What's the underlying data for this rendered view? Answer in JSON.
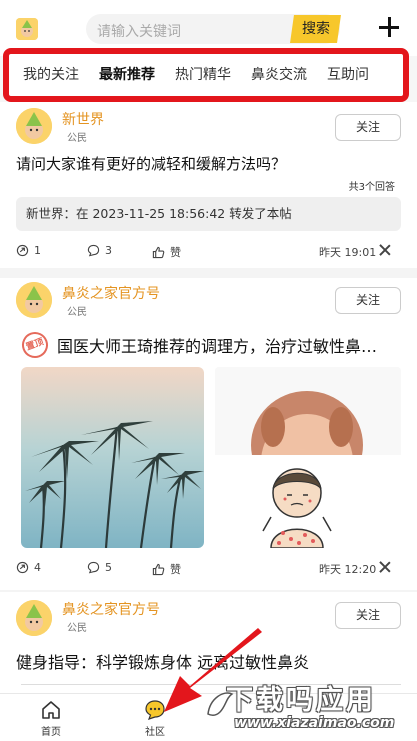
{
  "header": {
    "search_placeholder": "请输入关键词",
    "search_button": "搜索"
  },
  "tabs": [
    {
      "label": "我的关注"
    },
    {
      "label": "最新推荐"
    },
    {
      "label": "热门精华"
    },
    {
      "label": "鼻炎交流"
    },
    {
      "label": "互助问"
    }
  ],
  "posts": [
    {
      "author": "新世界",
      "role": "公民",
      "follow": "关注",
      "title": "请问大家谁有更好的减轻和缓解方法吗？",
      "answers": "共3个回答",
      "repost": "新世界：在 2023-11-25 18:56:42 转发了本帖",
      "shares": "1",
      "comments": "3",
      "like": "赞",
      "time": "昨天 19:01"
    },
    {
      "author": "鼻炎之家官方号",
      "role": "公民",
      "follow": "关注",
      "stamp": "置顶",
      "title": "国医大师王琦推荐的调理方，治疗过敏性鼻…",
      "shares": "4",
      "comments": "5",
      "like": "赞",
      "time": "昨天 12:20"
    },
    {
      "author": "鼻炎之家官方号",
      "role": "公民",
      "follow": "关注",
      "title": "健身指导：科学锻炼身体 远离过敏性鼻炎"
    }
  ],
  "bottom_nav": [
    {
      "label": "首页",
      "icon": "home-icon"
    },
    {
      "label": "社区",
      "icon": "chat-bubble-icon"
    }
  ],
  "watermark": {
    "title": "下载吗应用",
    "url": "www.xiazaimao.com"
  },
  "colors": {
    "accent": "#f7c72b",
    "highlight_border": "#e3161c",
    "author_name": "#e49422"
  }
}
